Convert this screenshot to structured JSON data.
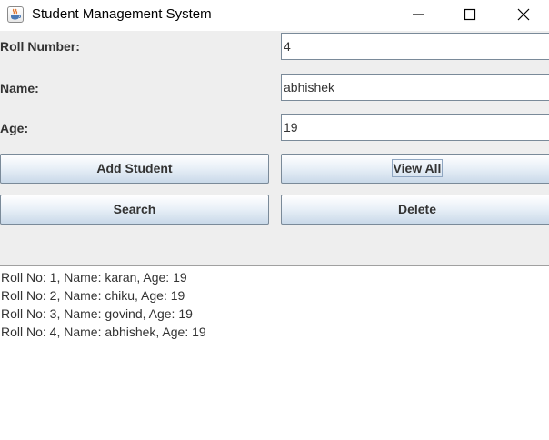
{
  "window": {
    "title": "Student Management System",
    "icon": "java-cup-icon",
    "controls": [
      "minimize-icon",
      "maximize-icon",
      "close-icon"
    ]
  },
  "form": {
    "roll_label": "Roll Number:",
    "roll_value": "4",
    "name_label": "Name:",
    "name_value": "abhishek",
    "age_label": "Age:",
    "age_value": "19"
  },
  "buttons": {
    "add": "Add Student",
    "view_all": "View All",
    "search": "Search",
    "delete": "Delete"
  },
  "output": {
    "lines": [
      "Roll No: 1, Name: karan, Age: 19",
      "Roll No: 2, Name: chiku, Age: 19",
      "Roll No: 3, Name: govind, Age: 19",
      "Roll No: 4, Name: abhishek, Age: 19"
    ]
  },
  "colors": {
    "button_top": "#ffffff",
    "button_bottom": "#c9d9e9",
    "panel_background": "#eeeeee",
    "text": "#333333"
  }
}
